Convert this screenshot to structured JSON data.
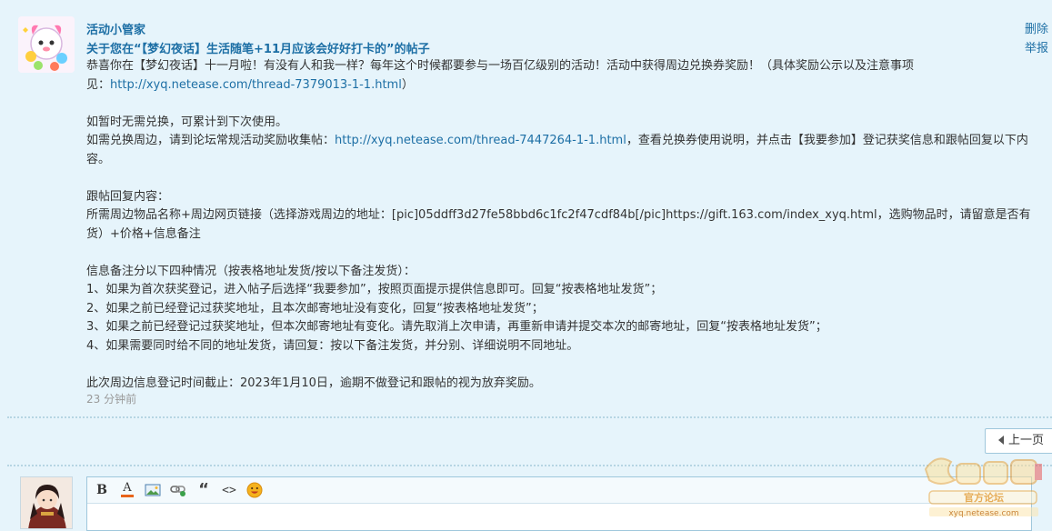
{
  "notice": {
    "sender": "活动小管家",
    "subject": "关于您在“【梦幻夜话】生活随笔+11月应该会好好打卡的”的帖子",
    "actions": {
      "delete": "删除",
      "report": "举报"
    },
    "line1_text": "恭喜你在【梦幻夜话】十一月啦！有没有人和我一样？每年这个时候都要参与一场百亿级别的活动！活动中获得周边兑换券奖励！（具体奖励公示以及注意事项",
    "line2_prefix": "见：",
    "line2_link": "http://xyq.netease.com/thread-7379013-1-1.html",
    "line2_suffix": "）",
    "line3": "如暂时无需兑换，可累计到下次使用。",
    "line4_prefix": "如需兑换周边，请到论坛常规活动奖励收集帖：",
    "line4_link": "http://xyq.netease.com/thread-7447264-1-1.html",
    "line4_suffix": "，查看兑换券使用说明，并点击【我要参加】登记获奖信息和跟帖回复以下内",
    "line5": "容。",
    "line6": "跟帖回复内容：",
    "line7": "所需周边物品名称+周边网页链接（选择游戏周边的地址：[pic]05ddff3d27fe58bbd6c1fc2f47cdf84b[/pic]https://gift.163.com/index_xyq.html，选购物品时，请留意是否有",
    "line8": "货）+价格+信息备注",
    "line9": "信息备注分以下四种情况（按表格地址发货/按以下备注发货）：",
    "line10": "1、如果为首次获奖登记，进入帖子后选择“我要参加”，按照页面提示提供信息即可。回复“按表格地址发货”；",
    "line11": "2、如果之前已经登记过获奖地址，且本次邮寄地址没有变化，回复“按表格地址发货”；",
    "line12": "3、如果之前已经登记过获奖地址，但本次邮寄地址有变化。请先取消上次申请，再重新申请并提交本次的邮寄地址，回复“按表格地址发货”；",
    "line13": "4、如果需要同时给不同的地址发货，请回复：按以下备注发货，并分别、详细说明不同地址。",
    "line14": "此次周边信息登记时间截止：2023年1月10日，逾期不做登记和跟帖的视为放弃奖励。",
    "time": "23 分钟前"
  },
  "pager": {
    "prev_label": "上一页"
  },
  "editor": {
    "toolbar": [
      "bold-icon",
      "font-color-icon",
      "image-icon",
      "link-icon",
      "quote-icon",
      "code-icon",
      "emoji-icon"
    ],
    "bold_glyph": "B",
    "font_color_glyph": "A",
    "quote_glyph": "“",
    "code_glyph": "<>"
  },
  "watermark": {
    "site": "xyq.netease.com",
    "tagline": "官方论坛"
  },
  "colors": {
    "link": "#1d6fa5",
    "background": "#e6f4fb",
    "time": "#999999"
  }
}
